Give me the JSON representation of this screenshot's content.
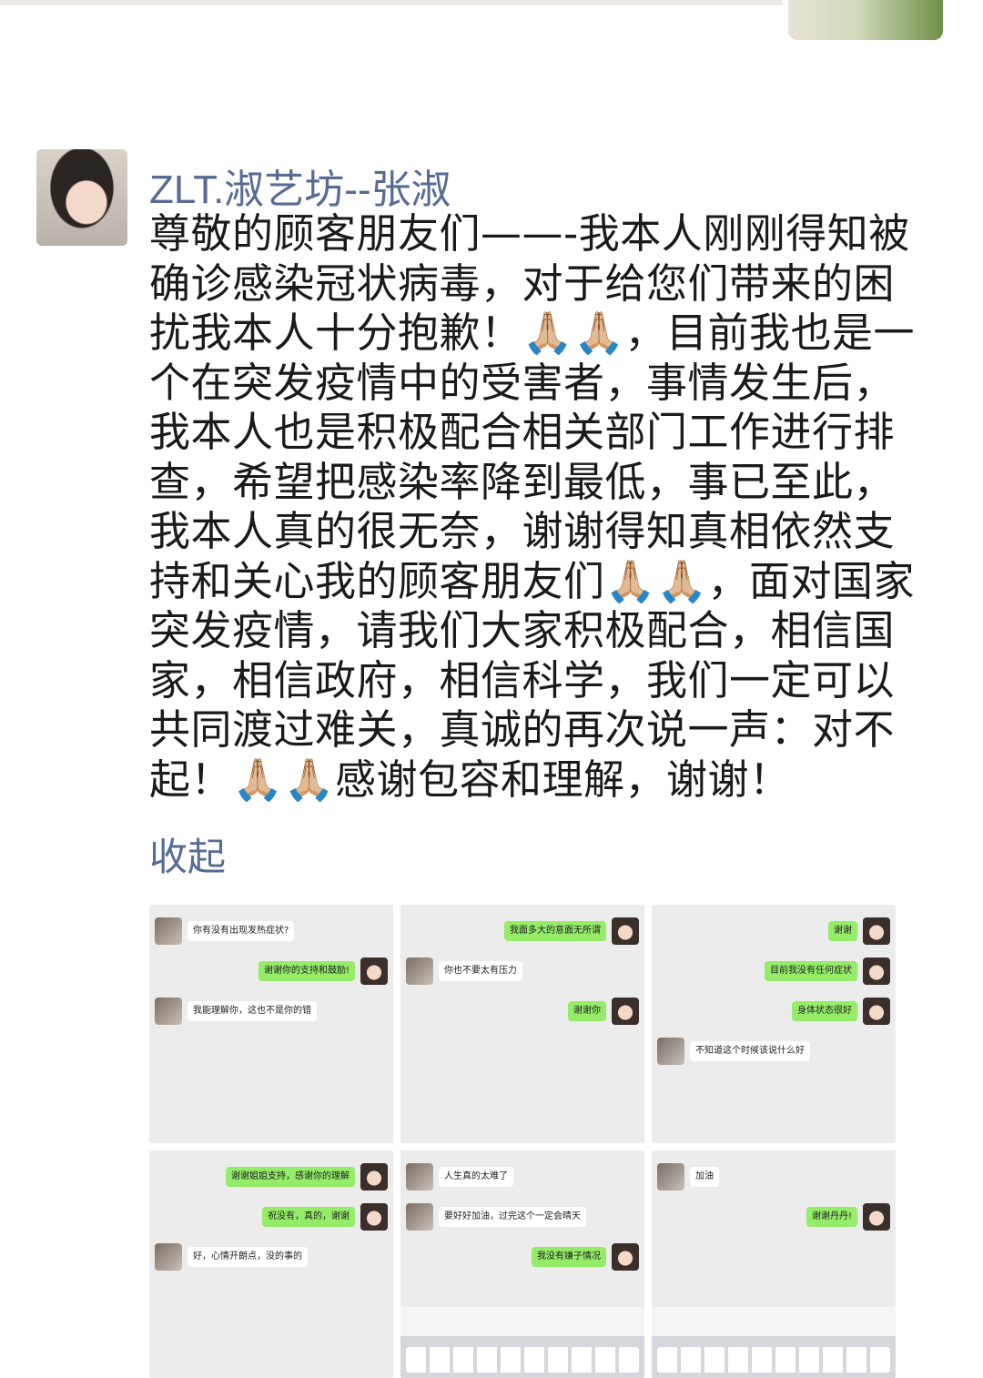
{
  "post": {
    "poster_name": "ZLT.淑艺坊--张淑",
    "text": "尊敬的顾客朋友们——-我本人刚刚得知被确诊感染冠状病毒，对于给您们带来的困扰我本人十分抱歉！🙏🏼🙏🏼，目前我也是一个在突发疫情中的受害者，事情发生后，我本人也是积极配合相关部门工作进行排查，希望把感染率降到最低，事已至此，我本人真的很无奈，谢谢得知真相依然支持和关心我的顾客朋友们🙏🏼🙏🏼，面对国家突发疫情，请我们大家积极配合，相信国家，相信政府，相信科学，我们一定可以共同渡过难关，真诚的再次说一声：对不起！🙏🏼🙏🏼感谢包容和理解，谢谢！",
    "collapse_label": "收起"
  },
  "screenshots": [
    {
      "name": "chat-screenshot-1",
      "messages": [
        {
          "side": "left",
          "text": "你有没有出现发热症状?"
        },
        {
          "side": "right",
          "text": "谢谢你的支持和鼓励!"
        },
        {
          "side": "left",
          "text": "我能理解你，这也不是你的错"
        }
      ]
    },
    {
      "name": "chat-screenshot-2",
      "messages": [
        {
          "side": "right",
          "text": "我面多大的意面无所谓"
        },
        {
          "side": "left",
          "text": "你也不要太有压力"
        },
        {
          "side": "right",
          "text": "谢谢你"
        }
      ]
    },
    {
      "name": "chat-screenshot-3",
      "messages": [
        {
          "side": "right",
          "text": "谢谢"
        },
        {
          "side": "right",
          "text": "目前我没有任何症状"
        },
        {
          "side": "right",
          "text": "身体状态很好"
        },
        {
          "side": "left",
          "text": "不知道这个时候该说什么好"
        }
      ]
    },
    {
      "name": "chat-screenshot-4",
      "messages": [
        {
          "side": "right",
          "text": "谢谢姐姐支持，感谢你的理解"
        },
        {
          "side": "right",
          "text": "祝没有，真的，谢谢"
        },
        {
          "side": "left",
          "text": "好，心情开朗点，没的事的"
        }
      ]
    },
    {
      "name": "chat-screenshot-5",
      "messages": [
        {
          "side": "left",
          "text": "人生真的太难了"
        },
        {
          "side": "left",
          "text": "要好好加油，过完这个一定会晴天"
        },
        {
          "side": "right",
          "text": "我没有嫌子情况"
        }
      ]
    },
    {
      "name": "chat-screenshot-6",
      "messages": [
        {
          "side": "left",
          "text": "加油"
        },
        {
          "side": "right",
          "text": "谢谢丹丹!"
        }
      ]
    }
  ]
}
